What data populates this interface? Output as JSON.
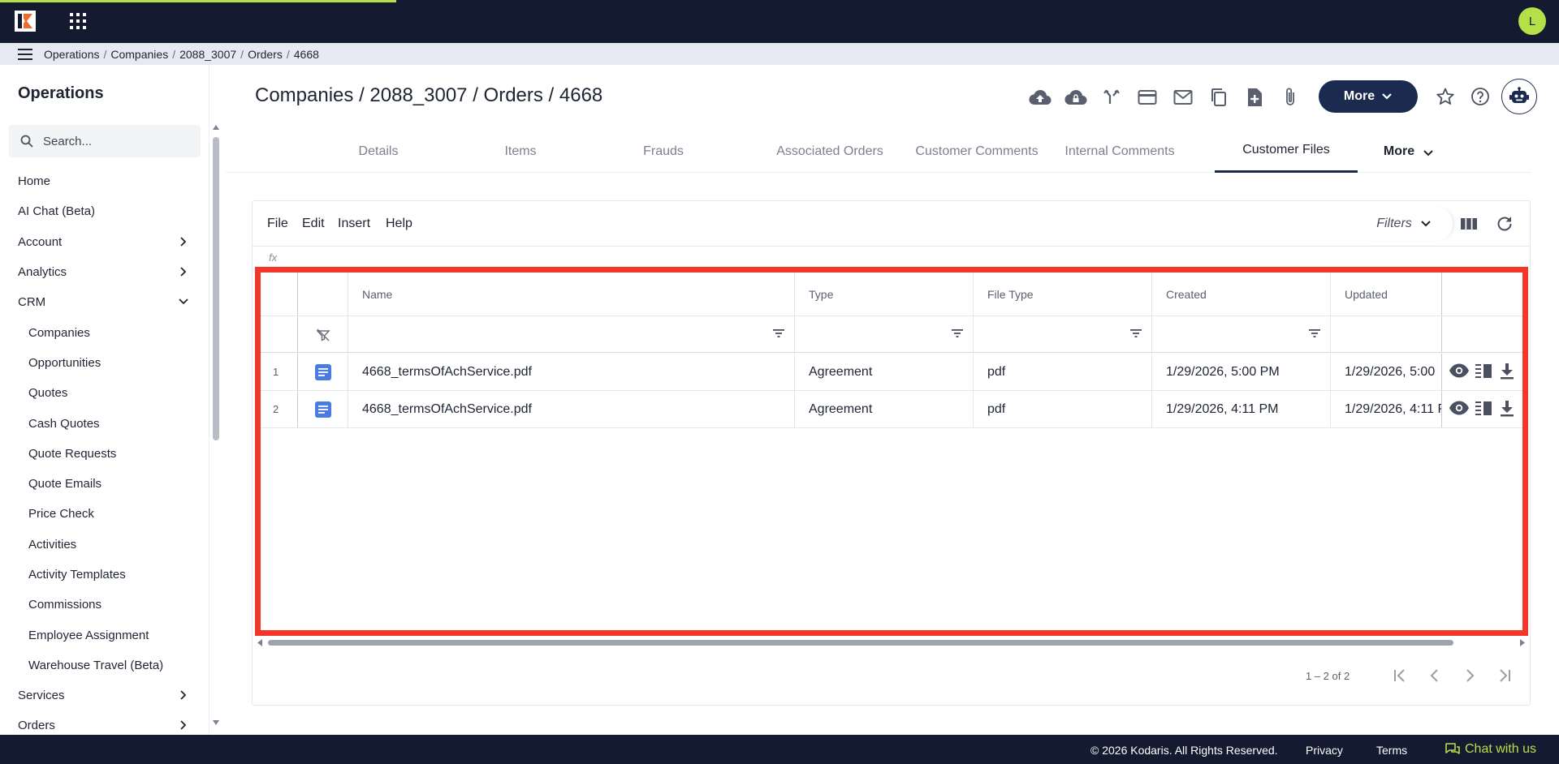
{
  "app": {
    "avatar_letter": "L",
    "accent_color": "#b5e04a",
    "topbar_color": "#141a30",
    "primary_color": "#1a2b4f",
    "highlight_color": "#f2372a"
  },
  "breadcrumb": {
    "items": [
      "Operations",
      "Companies",
      "2088_3007",
      "Orders",
      "4668"
    ],
    "separator": "/"
  },
  "sidebar": {
    "title": "Operations",
    "search_placeholder": "Search...",
    "items": [
      {
        "label": "Home",
        "expandable": false,
        "sub": false
      },
      {
        "label": "AI Chat (Beta)",
        "expandable": false,
        "sub": false
      },
      {
        "label": "Account",
        "expandable": true,
        "expanded": false,
        "sub": false
      },
      {
        "label": "Analytics",
        "expandable": true,
        "expanded": false,
        "sub": false
      },
      {
        "label": "CRM",
        "expandable": true,
        "expanded": true,
        "sub": false
      },
      {
        "label": "Companies",
        "sub": true
      },
      {
        "label": "Opportunities",
        "sub": true
      },
      {
        "label": "Quotes",
        "sub": true
      },
      {
        "label": "Cash Quotes",
        "sub": true
      },
      {
        "label": "Quote Requests",
        "sub": true
      },
      {
        "label": "Quote Emails",
        "sub": true
      },
      {
        "label": "Price Check",
        "sub": true
      },
      {
        "label": "Activities",
        "sub": true
      },
      {
        "label": "Activity Templates",
        "sub": true
      },
      {
        "label": "Commissions",
        "sub": true
      },
      {
        "label": "Employee Assignment",
        "sub": true
      },
      {
        "label": "Warehouse Travel (Beta)",
        "sub": true
      },
      {
        "label": "Services",
        "expandable": true,
        "expanded": false,
        "sub": false
      },
      {
        "label": "Orders",
        "expandable": true,
        "expanded": false,
        "sub": false
      }
    ]
  },
  "header": {
    "title": "Companies / 2088_3007 / Orders / 4668",
    "more_label": "More",
    "action_icons": [
      "cloud-upload-icon",
      "cloud-lock-icon",
      "merge-icon",
      "credit-card-icon",
      "mail-icon",
      "copy-icon",
      "add-document-icon",
      "attachment-icon"
    ]
  },
  "tabs": [
    {
      "label": "Details",
      "active": false
    },
    {
      "label": "Items",
      "active": false
    },
    {
      "label": "Frauds",
      "active": false
    },
    {
      "label": "Associated Orders",
      "active": false
    },
    {
      "label": "Customer Comments",
      "active": false
    },
    {
      "label": "Internal Comments",
      "active": false
    },
    {
      "label": "Customer Files",
      "active": true
    },
    {
      "label": "More",
      "active": false
    }
  ],
  "grid": {
    "menu": [
      "File",
      "Edit",
      "Insert",
      "Help"
    ],
    "filters_label": "Filters",
    "formula_symbol": "fx",
    "columns": [
      "Name",
      "Type",
      "File Type",
      "Created",
      "Updated"
    ],
    "rows": [
      {
        "num": "1",
        "name": "4668_termsOfAchService.pdf",
        "type": "Agreement",
        "file_type": "pdf",
        "created": "1/29/2026, 5:00 PM",
        "updated": "1/29/2026, 5:00"
      },
      {
        "num": "2",
        "name": "4668_termsOfAchService.pdf",
        "type": "Agreement",
        "file_type": "pdf",
        "created": "1/29/2026, 4:11 PM",
        "updated": "1/29/2026, 4:11 P"
      }
    ],
    "pagination": "1 – 2 of 2"
  },
  "footer": {
    "copyright": "© 2026 Kodaris. All Rights Reserved.",
    "privacy": "Privacy",
    "terms": "Terms",
    "chat": "Chat with us"
  }
}
